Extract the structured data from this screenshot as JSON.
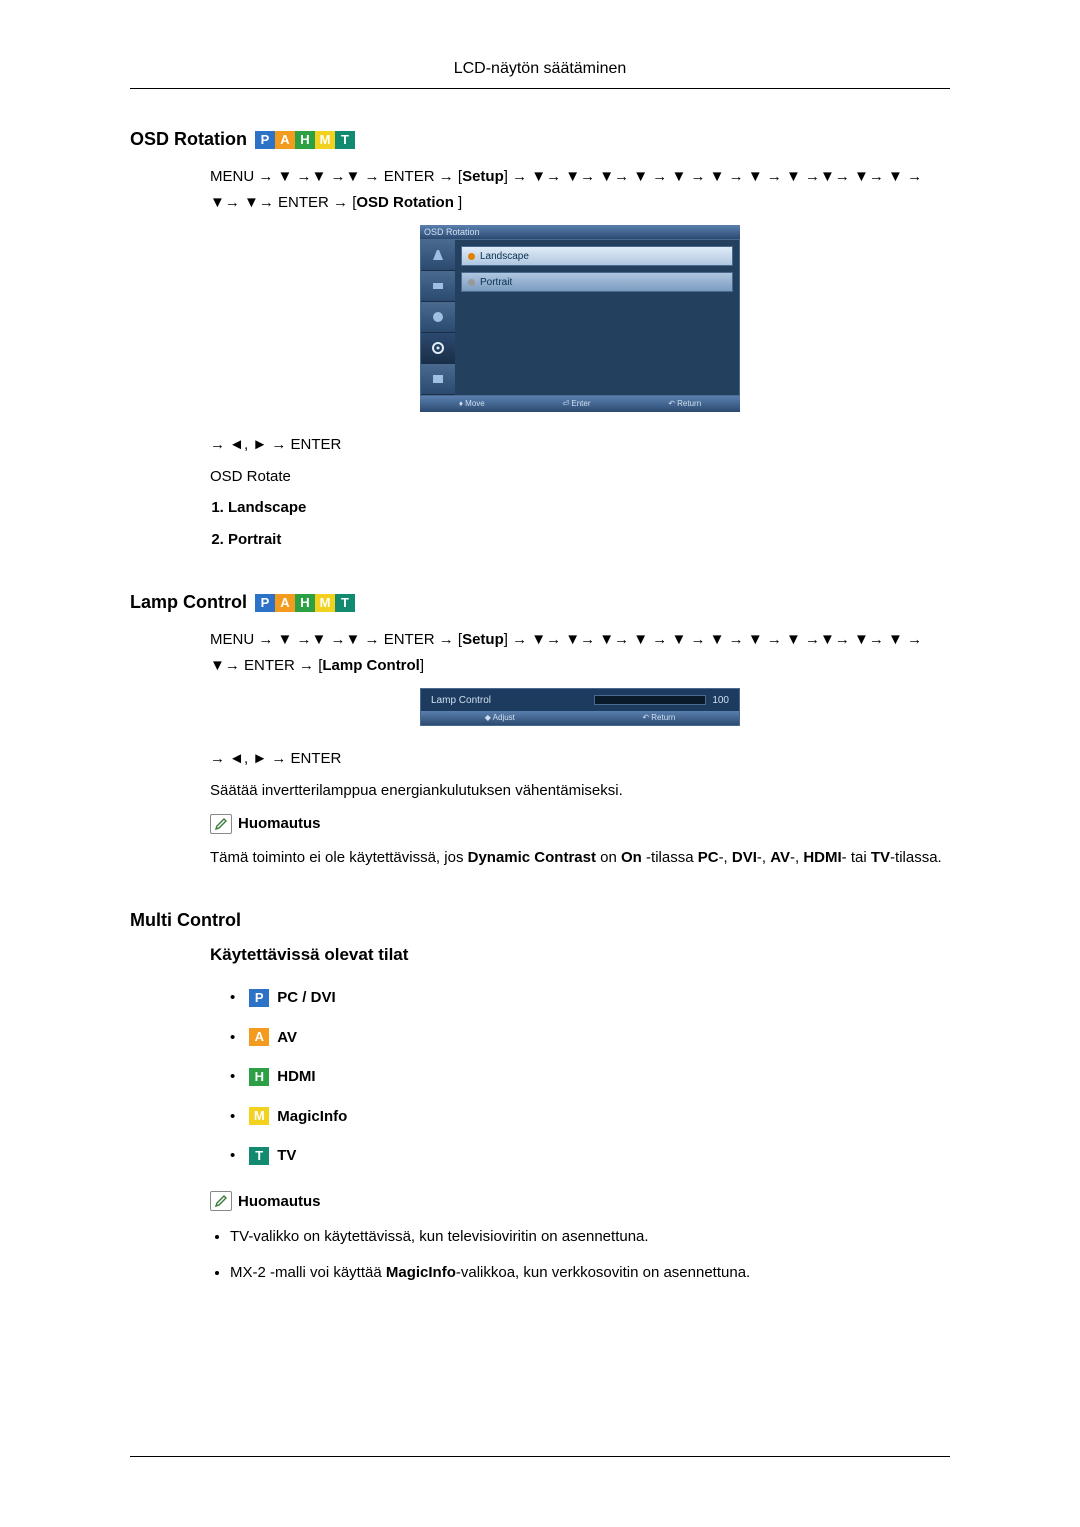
{
  "header": {
    "title": "LCD-näytön säätäminen"
  },
  "badges": {
    "P": "P",
    "A": "A",
    "H": "H",
    "M": "M",
    "T": "T"
  },
  "osd_rotation": {
    "heading": "OSD Rotation",
    "path1": "MENU → ▼ →▼ →▼ → ENTER → ",
    "path1_setup": "Setup",
    "path1_tail": " → ▼→ ▼→ ▼→ ▼ → ▼ → ▼ → ▼ → ▼ →▼→ ▼→ ▼ → ▼→ ▼→ ENTER → ",
    "path1_target": "OSD Rotation",
    "path1_close": " ]",
    "screenshot": {
      "title": "OSD Rotation",
      "opt1": "Landscape",
      "opt2": "Portrait",
      "f1": "Move",
      "f2": "Enter",
      "f3": "Return"
    },
    "nav2": "→ ◄, ► → ENTER",
    "desc": "OSD Rotate",
    "list": {
      "i1": "Landscape",
      "i2": "Portrait"
    }
  },
  "lamp_control": {
    "heading": "Lamp Control",
    "path1": "MENU → ▼ →▼ →▼ → ENTER → ",
    "path1_setup": "Setup",
    "path1_tail": " → ▼→ ▼→ ▼→ ▼ → ▼ → ▼ → ▼ → ▼ →▼→ ▼→ ▼ → ▼→ ENTER → ",
    "path1_target": "Lamp Control",
    "screenshot": {
      "label": "Lamp Control",
      "value": "100",
      "f1": "Adjust",
      "f2": "Return"
    },
    "nav2": "→ ◄, ► → ENTER",
    "desc": "Säätää invertterilamppua energiankulutuksen vähentämiseksi.",
    "note_label": "Huomautus",
    "note_text_pre": "Tämä toiminto ei ole käytettävissä, jos ",
    "note_dc": "Dynamic Contrast",
    "note_is": " on ",
    "note_on": "On",
    "note_mid": "-tilassa ",
    "note_pc": "PC",
    "note_sep": "-, ",
    "note_dvi": "DVI",
    "note_av": "AV",
    "note_hdmi": "HDMI",
    "note_or": "- tai ",
    "note_tv": "TV",
    "note_end": "-tilassa."
  },
  "multi_control": {
    "heading": "Multi Control",
    "sub": "Käytettävissä olevat tilat",
    "modes": {
      "pc": "PC / DVI",
      "av": "AV",
      "hdmi": "HDMI",
      "magic": "MagicInfo",
      "tv": "TV"
    },
    "note_label": "Huomautus",
    "notes": {
      "n1": "TV-valikko on käytettävissä, kun televisioviritin on asennettuna.",
      "n2_pre": "MX-2 -malli voi käyttää ",
      "n2_mi": "MagicInfo",
      "n2_post": "-valikkoa, kun verkkosovitin on asennettuna."
    }
  }
}
